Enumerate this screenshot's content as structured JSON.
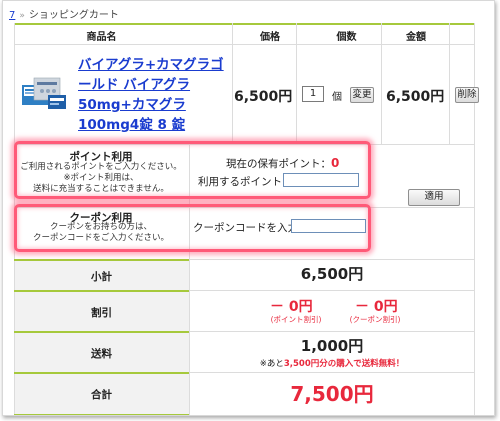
{
  "breadcrumb": {
    "home": "7",
    "separator": "»",
    "current": "ショッピングカート"
  },
  "table_header": {
    "product": "商品名",
    "price": "価格",
    "quantity": "個数",
    "amount": "金額"
  },
  "item": {
    "image_icon": "medicine-box-image",
    "name": "バイアグラ+カマグラゴールド バイアグラ50mg+カマグラ100mg4錠 8 錠",
    "price": "6,500円",
    "quantity": "1",
    "quantity_unit": "個",
    "change_label": "変更",
    "amount": "6,500円",
    "delete_label": "削除"
  },
  "points": {
    "title": "ポイント利用",
    "desc1": "ご利用されるポイントをご入力ください。",
    "desc2": "※ポイント利用は、",
    "desc3": "送料に充当することはできません。",
    "current_label": "現在の保有ポイント：",
    "current_value": "0",
    "use_label": "利用するポイント：",
    "use_value": ""
  },
  "coupon": {
    "title": "クーポン利用",
    "desc1": "クーポンをお持ちの方は、",
    "desc2": "クーポンコードをご入力ください。",
    "code_label": "クーポンコードを入力",
    "code_value": ""
  },
  "apply_label": "適用",
  "summary": {
    "subtotal_label": "小計",
    "subtotal_value": "6,500円",
    "discount_label": "割引",
    "point_discount": "－ 0円",
    "point_discount_note": "(ポイント割引)",
    "coupon_discount": "－ 0円",
    "coupon_discount_note": "(クーポン割引)",
    "shipping_label": "送料",
    "shipping_value": "1,000円",
    "shipping_note_prefix": "※あと",
    "shipping_note_amount": "3,500円分の購入で送料無料！",
    "total_label": "合計",
    "total_value": "7,500円"
  },
  "colors": {
    "accent_green": "#a6c93c",
    "link_blue": "#1a3ccf",
    "price_red": "#e8283c",
    "highlight_pink": "#ff5a78"
  }
}
